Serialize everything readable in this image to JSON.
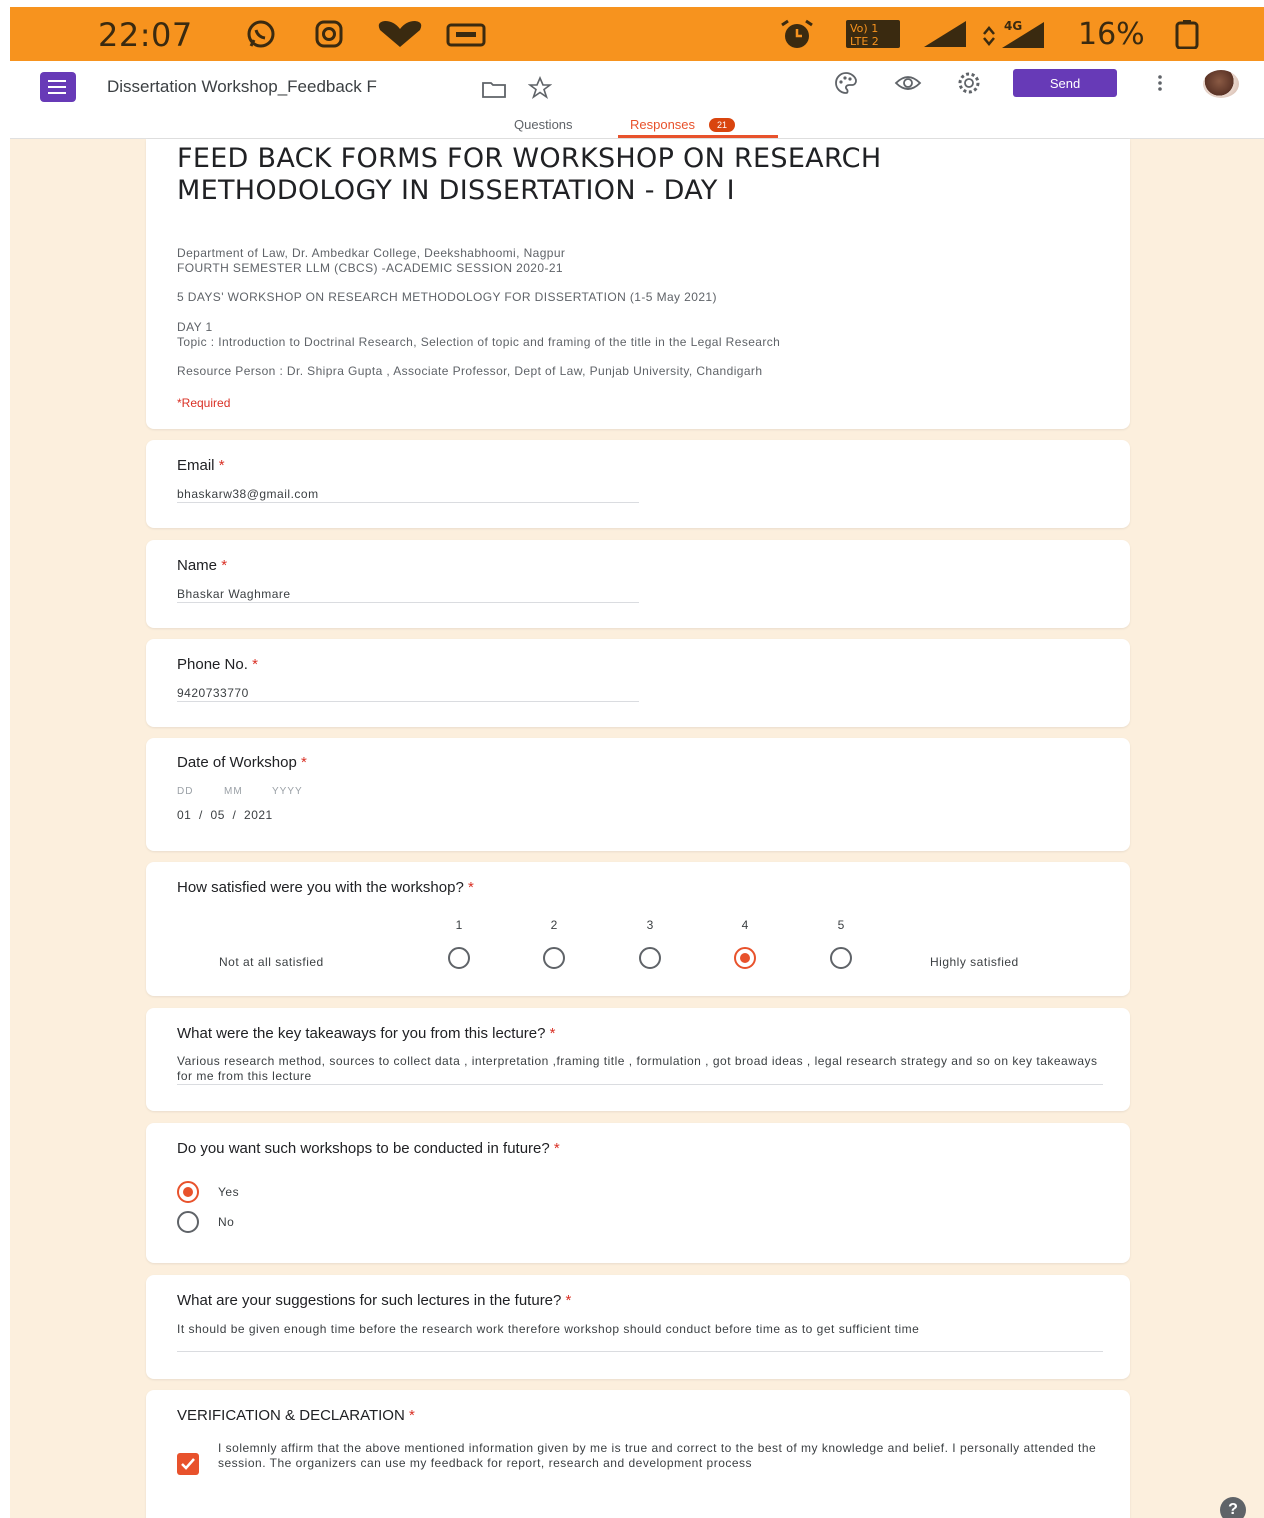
{
  "status_bar": {
    "time": "22:07",
    "network": "4G",
    "battery": "16%",
    "icons": [
      "whatsapp-icon",
      "instagram-icon",
      "heart-icon",
      "message-icon",
      "alarm-icon",
      "volte-icon",
      "signal-icon",
      "battery-icon"
    ],
    "volte_label": "Vo) 1 LTE 2",
    "bg_color": "#f7931e"
  },
  "app_bar": {
    "doc_title": "Dissertation Workshop_Feedback F",
    "send_label": "Send",
    "accent": "#673ab7"
  },
  "tabs": [
    {
      "label": "Questions"
    },
    {
      "label": "Responses",
      "badge": "21"
    }
  ],
  "header": {
    "title": "FEED BACK FORMS FOR WORKSHOP ON RESEARCH METHODOLOGY IN DISSERTATION - DAY I",
    "dept": "Department of Law, Dr. Ambedkar College, Deekshabhoomi, Nagpur",
    "semester": "FOURTH SEMESTER LLM (CBCS) -ACADEMIC SESSION 2020-21",
    "workshop": "5 DAYS' WORKSHOP ON RESEARCH METHODOLOGY FOR DISSERTATION (1-5 May 2021)",
    "day": "DAY 1",
    "topic": "Topic : Introduction to Doctrinal Research, Selection of topic and framing of the title in the Legal Research",
    "resource": "Resource Person :  Dr. Shipra Gupta , Associate Professor, Dept of Law, Punjab University, Chandigarh",
    "required": "*Required"
  },
  "questions": {
    "email": {
      "label": "Email",
      "value": "bhaskarw38@gmail.com"
    },
    "name": {
      "label": "Name",
      "value": "Bhaskar Waghmare"
    },
    "phone": {
      "label": "Phone No.",
      "value": "9420733770"
    },
    "date": {
      "label": "Date of Workshop",
      "dd": "DD",
      "mm": "MM",
      "yyyy": "YYYY",
      "value": "01  /  05  /  2021"
    },
    "satisfaction": {
      "label": "How satisfied were you with the workshop?",
      "low": "Not at all satisfied",
      "high": "Highly satisfied",
      "options": [
        "1",
        "2",
        "3",
        "4",
        "5"
      ],
      "selected": 4
    },
    "takeaways": {
      "label": "What were the key takeaways for you from this lecture?",
      "value": "Various research method, sources to collect data , interpretation ,framing title , formulation , got broad ideas , legal research strategy and so on key takeaways for me from this lecture"
    },
    "future": {
      "label": "Do you want such workshops to be conducted in future?",
      "options": [
        "Yes",
        "No"
      ],
      "selected": "Yes"
    },
    "suggestions": {
      "label": "What are your suggestions for such lectures in the future?",
      "value": "It should be given enough time before the research work therefore workshop should conduct before time as to get sufficient time"
    },
    "declaration": {
      "label": "VERIFICATION & DECLARATION",
      "text": "I solemnly affirm that the above mentioned information given by me is true and correct to the best of my knowledge and belief. I personally attended the session. The organizers can use my feedback for report, research and development process",
      "checked": true
    }
  },
  "help_label": "?"
}
